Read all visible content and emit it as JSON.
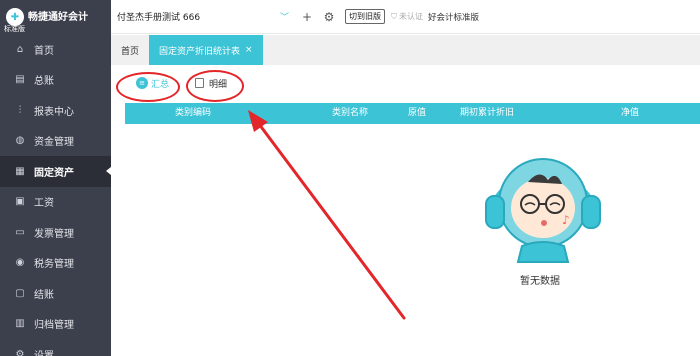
{
  "brand": {
    "name": "畅捷通好会计",
    "badge": "标准版"
  },
  "sidebar": {
    "items": [
      {
        "label": "首页",
        "icon": "home-icon"
      },
      {
        "label": "总账",
        "icon": "ledger-icon"
      },
      {
        "label": "报表中心",
        "icon": "chart-icon"
      },
      {
        "label": "资金管理",
        "icon": "money-bag-icon"
      },
      {
        "label": "固定资产",
        "icon": "building-icon",
        "active": true
      },
      {
        "label": "工资",
        "icon": "salary-icon"
      },
      {
        "label": "发票管理",
        "icon": "invoice-icon"
      },
      {
        "label": "税务管理",
        "icon": "tax-icon"
      },
      {
        "label": "结账",
        "icon": "checkout-icon"
      },
      {
        "label": "归档管理",
        "icon": "archive-icon"
      },
      {
        "label": "设置",
        "icon": "gear-icon"
      }
    ]
  },
  "topbar": {
    "account_name": "付圣杰手册测试 666",
    "switch_label": "切到旧版",
    "unverified_label": "未认证",
    "edition_label": "好会计标准版"
  },
  "tabs": [
    {
      "label": "首页"
    },
    {
      "label": "固定资产折旧统计表",
      "active": true,
      "close": "×"
    }
  ],
  "toolbar": {
    "summary_label": "汇总",
    "detail_label": "明细"
  },
  "table": {
    "columns": [
      "类别编码",
      "类别名称",
      "原值",
      "期初累计折旧",
      "净值"
    ]
  },
  "empty_state": {
    "text": "暂无数据"
  },
  "colors": {
    "accent": "#3cc3d6",
    "sidebar_bg": "#3c3f4c",
    "annotation_red": "#e3262a"
  }
}
